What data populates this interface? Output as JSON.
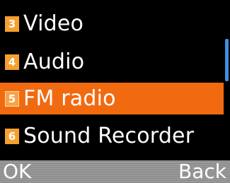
{
  "menu": {
    "items": [
      {
        "number": "3",
        "label": "Video",
        "selected": false
      },
      {
        "number": "4",
        "label": "Audio",
        "selected": false
      },
      {
        "number": "5",
        "label": "FM radio",
        "selected": true
      },
      {
        "number": "6",
        "label": "Sound Recorder",
        "selected": false
      }
    ]
  },
  "softkeys": {
    "left": "OK",
    "right": "Back"
  },
  "colors": {
    "selected_background": "#f26a10",
    "badge": "#f5a030",
    "scrollbar_thumb": "#3d8fe0",
    "softkey_bar": "#9a9a9a"
  }
}
